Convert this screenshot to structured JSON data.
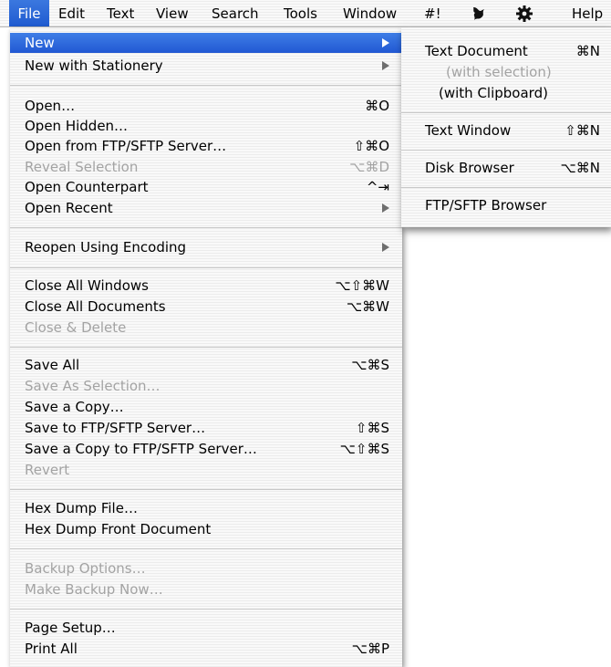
{
  "menubar": {
    "items": [
      "File",
      "Edit",
      "Text",
      "View",
      "Search",
      "Tools",
      "Window",
      "#!",
      "Help"
    ],
    "icons": [
      "script-icon",
      "gear-icon"
    ]
  },
  "file_menu": {
    "new": "New",
    "new_stationery": "New with Stationery",
    "open": "Open…",
    "open_sc": "⌘O",
    "open_hidden": "Open Hidden…",
    "open_ftp": "Open from FTP/SFTP Server…",
    "open_ftp_sc": "⇧⌘O",
    "reveal": "Reveal Selection",
    "reveal_sc": "⌥⌘D",
    "counterpart": "Open Counterpart",
    "counterpart_sc": "^⇥",
    "recent": "Open Recent",
    "reopen_enc": "Reopen Using Encoding",
    "close_windows": "Close All Windows",
    "close_windows_sc": "⌥⇧⌘W",
    "close_docs": "Close All Documents",
    "close_docs_sc": "⌥⌘W",
    "close_delete": "Close & Delete",
    "save_all": "Save All",
    "save_all_sc": "⌥⌘S",
    "save_selection": "Save As Selection…",
    "save_copy": "Save a Copy…",
    "save_ftp": "Save to FTP/SFTP Server…",
    "save_ftp_sc": "⇧⌘S",
    "save_copy_ftp": "Save a Copy to FTP/SFTP Server…",
    "save_copy_ftp_sc": "⌥⇧⌘S",
    "revert": "Revert",
    "hex_file": "Hex Dump File…",
    "hex_front": "Hex Dump Front Document",
    "backup_options": "Backup Options…",
    "backup_now": "Make Backup Now…",
    "page_setup": "Page Setup…",
    "print_all": "Print All",
    "print_all_sc": "⌥⌘P"
  },
  "sub_menu": {
    "text_doc": "Text Document",
    "text_doc_sc": "⌘N",
    "with_selection": "(with selection)",
    "with_clipboard": "(with Clipboard)",
    "text_window": "Text Window",
    "text_window_sc": "⇧⌘N",
    "disk_browser": "Disk Browser",
    "disk_browser_sc": "⌥⌘N",
    "ftp_browser": "FTP/SFTP Browser"
  },
  "colors": {
    "highlight": "#2a64d9",
    "disabled": "#a3a3a3"
  }
}
